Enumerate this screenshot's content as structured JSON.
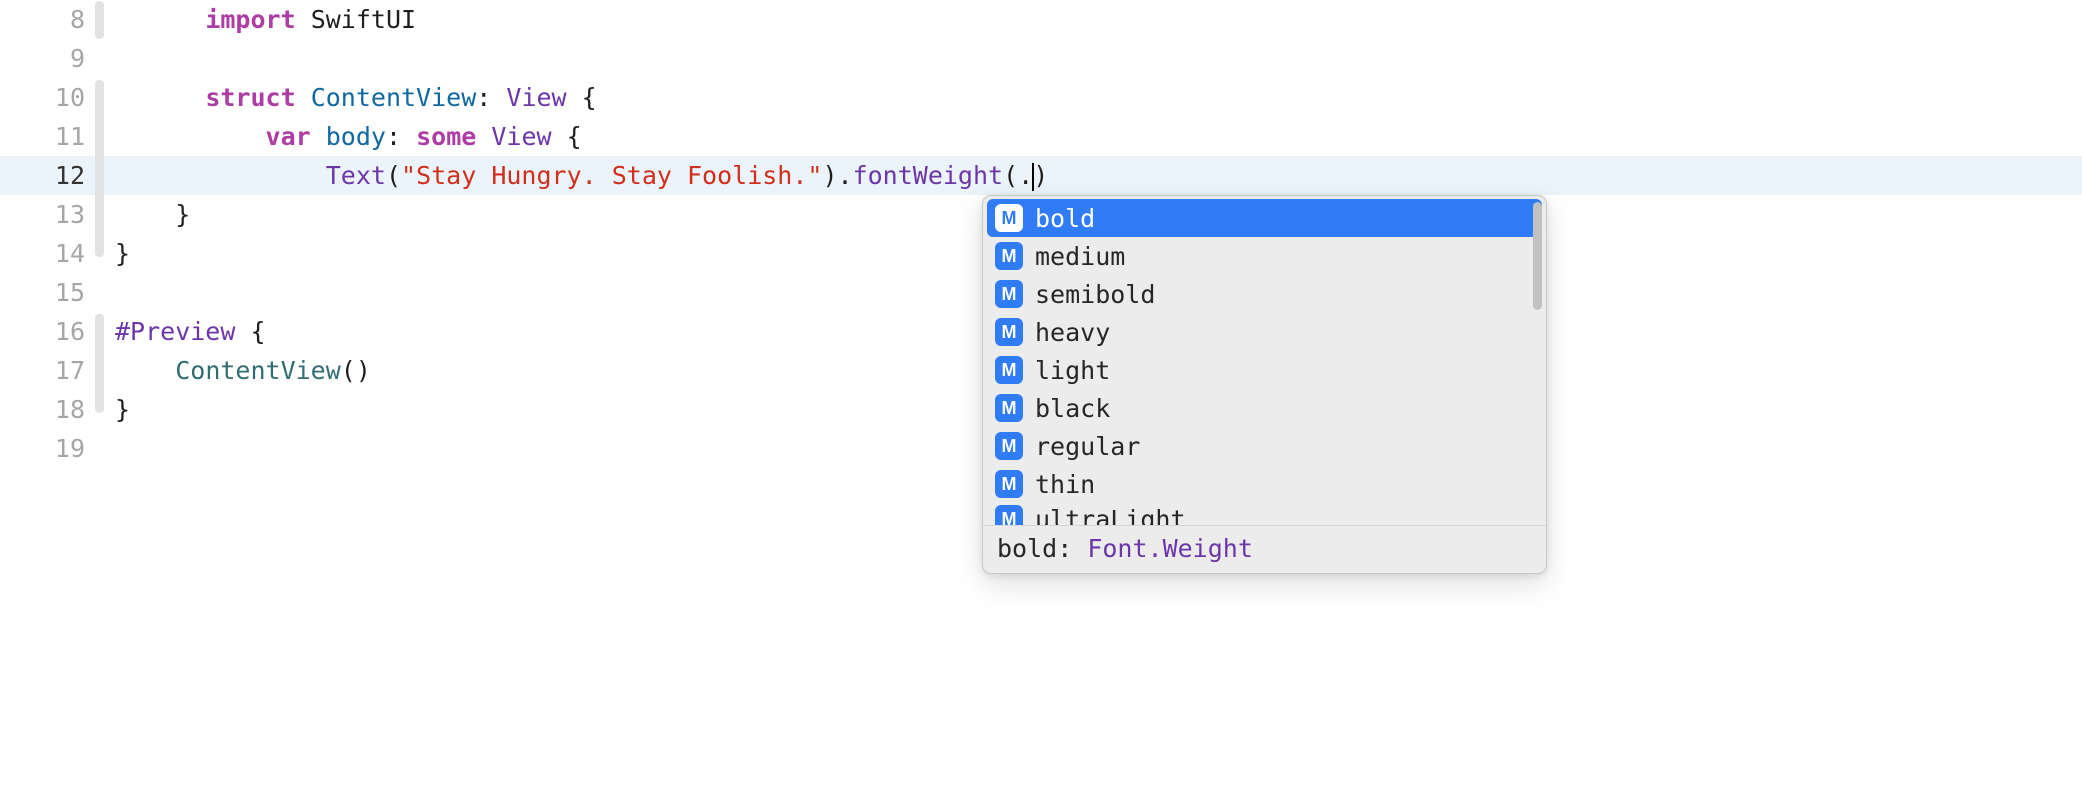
{
  "lines": [
    {
      "num": "8"
    },
    {
      "num": "9"
    },
    {
      "num": "10"
    },
    {
      "num": "11"
    },
    {
      "num": "12"
    },
    {
      "num": "13"
    },
    {
      "num": "14"
    },
    {
      "num": "15"
    },
    {
      "num": "16"
    },
    {
      "num": "17"
    },
    {
      "num": "18"
    },
    {
      "num": "19"
    }
  ],
  "code": {
    "l8": {
      "import": "import",
      "module": "SwiftUI"
    },
    "l10": {
      "struct": "struct",
      "name": "ContentView",
      "colon": ":",
      "proto": "View",
      "brace": " {"
    },
    "l11": {
      "var": "var",
      "body": "body",
      "colon": ":",
      "some": "some",
      "view": "View",
      "brace": " {"
    },
    "l12": {
      "text": "Text",
      "paren1": "(",
      "string": "\"Stay Hungry. Stay Foolish.\"",
      "paren2": ")",
      "dot": ".",
      "fontWeight": "fontWeight",
      "paren3": "(",
      "dot2": ".",
      "paren4": ")"
    },
    "l13": {
      "brace": "}"
    },
    "l14": {
      "brace": "}"
    },
    "l16": {
      "preview": "#Preview",
      "brace": " {"
    },
    "l17": {
      "cv": "ContentView",
      "parens": "()"
    },
    "l18": {
      "brace": "}"
    }
  },
  "autocomplete": {
    "icon_letter": "M",
    "items": [
      {
        "label": "bold",
        "selected": true
      },
      {
        "label": "medium",
        "selected": false
      },
      {
        "label": "semibold",
        "selected": false
      },
      {
        "label": "heavy",
        "selected": false
      },
      {
        "label": "light",
        "selected": false
      },
      {
        "label": "black",
        "selected": false
      },
      {
        "label": "regular",
        "selected": false
      },
      {
        "label": "thin",
        "selected": false
      },
      {
        "label": "ultraLight",
        "selected": false,
        "cutoff": true
      }
    ],
    "detail": {
      "name": "bold",
      "sep": ": ",
      "type": "Font.Weight"
    }
  }
}
